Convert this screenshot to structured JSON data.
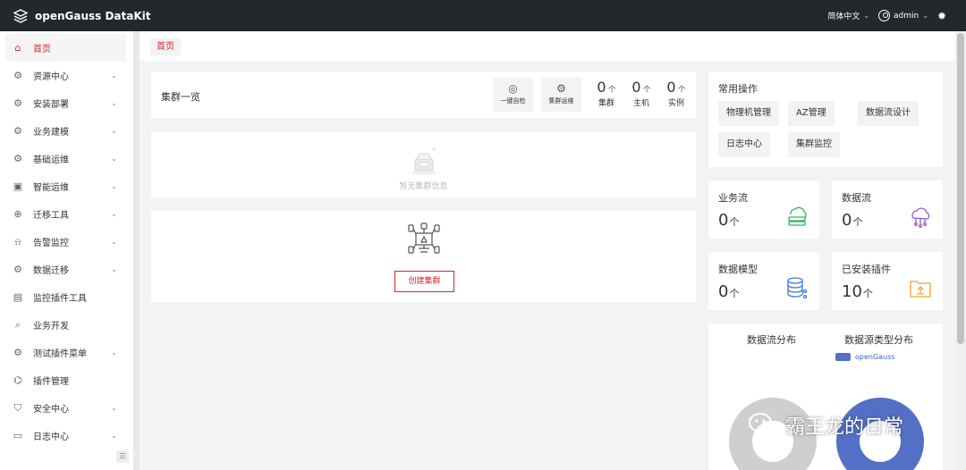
{
  "app": {
    "title": "openGauss DataKit"
  },
  "topbar": {
    "language": "简体中文",
    "user": "admin"
  },
  "sidebar": {
    "items": [
      {
        "label": "首页",
        "icon": "home-icon",
        "active": true,
        "expandable": false
      },
      {
        "label": "资源中心",
        "icon": "gear-icon",
        "expandable": true
      },
      {
        "label": "安装部署",
        "icon": "gear-icon",
        "expandable": true
      },
      {
        "label": "业务建模",
        "icon": "gear-icon",
        "expandable": true
      },
      {
        "label": "基础运维",
        "icon": "gear-icon",
        "expandable": true
      },
      {
        "label": "智能运维",
        "icon": "monitor-icon",
        "expandable": true
      },
      {
        "label": "迁移工具",
        "icon": "plus-circle-icon",
        "expandable": true
      },
      {
        "label": "告警监控",
        "icon": "alarm-icon",
        "expandable": true
      },
      {
        "label": "数据迁移",
        "icon": "gear-icon",
        "expandable": true
      },
      {
        "label": "监控插件工具",
        "icon": "dashboard-icon",
        "expandable": false
      },
      {
        "label": "业务开发",
        "icon": "search-icon",
        "expandable": false
      },
      {
        "label": "测试插件菜单",
        "icon": "gear-icon",
        "expandable": true
      },
      {
        "label": "插件管理",
        "icon": "plugin-icon",
        "expandable": false
      },
      {
        "label": "安全中心",
        "icon": "shield-icon",
        "expandable": true
      },
      {
        "label": "日志中心",
        "icon": "document-icon",
        "expandable": true
      }
    ]
  },
  "breadcrumb": {
    "current": "首页"
  },
  "cluster": {
    "title": "集群一览",
    "tools": [
      {
        "label": "一键自检"
      },
      {
        "label": "集群运维"
      }
    ],
    "stats": [
      {
        "value": "0",
        "unit": "个",
        "label": "集群"
      },
      {
        "value": "0",
        "unit": "个",
        "label": "主机"
      },
      {
        "value": "0",
        "unit": "个",
        "label": "实例"
      }
    ],
    "empty_text": "暂无集群信息",
    "create_button": "创建集群"
  },
  "ops": {
    "title": "常用操作",
    "buttons": [
      "物理机管理",
      "AZ管理",
      "数据流设计",
      "日志中心",
      "集群监控"
    ]
  },
  "metrics": [
    {
      "title": "业务流",
      "value": "0",
      "unit": "个",
      "icon": "cloud-server-icon",
      "color": "#2db55d"
    },
    {
      "title": "数据流",
      "value": "0",
      "unit": "个",
      "icon": "cloud-flow-icon",
      "color": "#9b59c9"
    },
    {
      "title": "数据模型",
      "value": "0",
      "unit": "个",
      "icon": "database-icon",
      "color": "#3a7bd5"
    },
    {
      "title": "已安装插件",
      "value": "10",
      "unit": "个",
      "icon": "folder-upload-icon",
      "color": "#f2a23a"
    }
  ],
  "distribution": {
    "flow_title": "数据流分布",
    "source_title": "数据源类型分布",
    "legend_label": "openGauss",
    "legend_color": "#5370c6"
  },
  "watermark": {
    "text": "霸王龙的日常"
  }
}
